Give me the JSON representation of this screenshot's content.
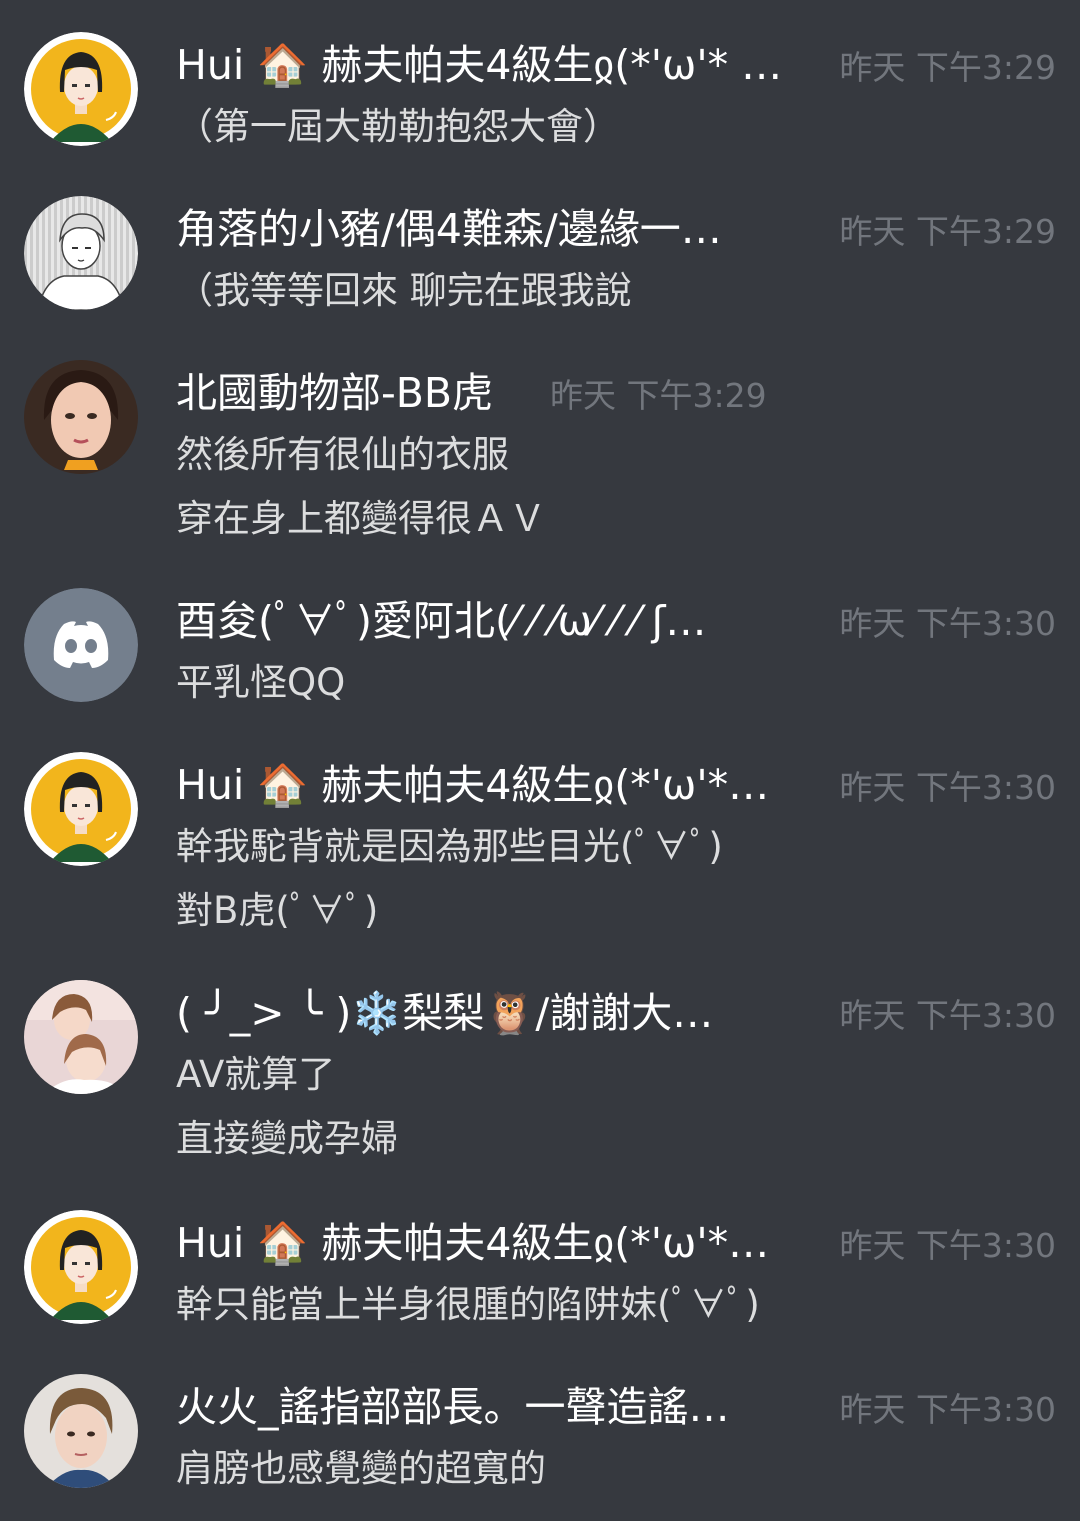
{
  "messages": [
    {
      "username": "Hui 🏠 赫夫帕夫4級生ჲ(*'ω'* …",
      "timestamp": "昨天 下午3:29",
      "avatar": "avatar-girl-yellow",
      "lines": [
        "（第一屆大勒勒抱怨大會）"
      ]
    },
    {
      "username": "角落的小豬/偶4難森/邊緣一…",
      "timestamp": "昨天 下午3:29",
      "avatar": "avatar-sketch-boy",
      "lines": [
        "（我等等回來  聊完在跟我說"
      ]
    },
    {
      "username": "北國動物部-BB虎",
      "timestamp": "昨天 下午3:29",
      "avatar": "avatar-photo-girl",
      "lines": [
        "然後所有很仙的衣服",
        "穿在身上都變得很ＡＶ"
      ]
    },
    {
      "username": "酉夋(ﾟ∀ﾟ)愛阿北(⁄ ⁄ ⁄ω⁄ ⁄ ⁄ ʃ…",
      "timestamp": "昨天 下午3:30",
      "avatar": "discord-logo-icon",
      "lines": [
        "平乳怪QQ"
      ]
    },
    {
      "username": "Hui 🏠 赫夫帕夫4級生ჲ(*'ω'*…",
      "timestamp": "昨天 下午3:30",
      "avatar": "avatar-girl-yellow",
      "lines": [
        "幹我駝背就是因為那些目光(ﾟ∀ﾟ)",
        "對B虎(ﾟ∀ﾟ)"
      ]
    },
    {
      "username": "( ╯_> ╰ )❄️梨梨🦉/謝謝大…",
      "timestamp": "昨天 下午3:30",
      "avatar": "avatar-photo-pair",
      "lines": [
        "AV就算了",
        "直接變成孕婦"
      ]
    },
    {
      "username": "Hui 🏠 赫夫帕夫4級生ჲ(*'ω'*…",
      "timestamp": "昨天 下午3:30",
      "avatar": "avatar-girl-yellow",
      "lines": [
        "幹只能當上半身很腫的陷阱妹(ﾟ∀ﾟ)"
      ]
    },
    {
      "username": "火火_謠指部部長。一聲造謠…",
      "timestamp": "昨天 下午3:30",
      "avatar": "avatar-photo-shorthair",
      "lines": [
        "肩膀也感覺變的超寬的"
      ]
    }
  ]
}
